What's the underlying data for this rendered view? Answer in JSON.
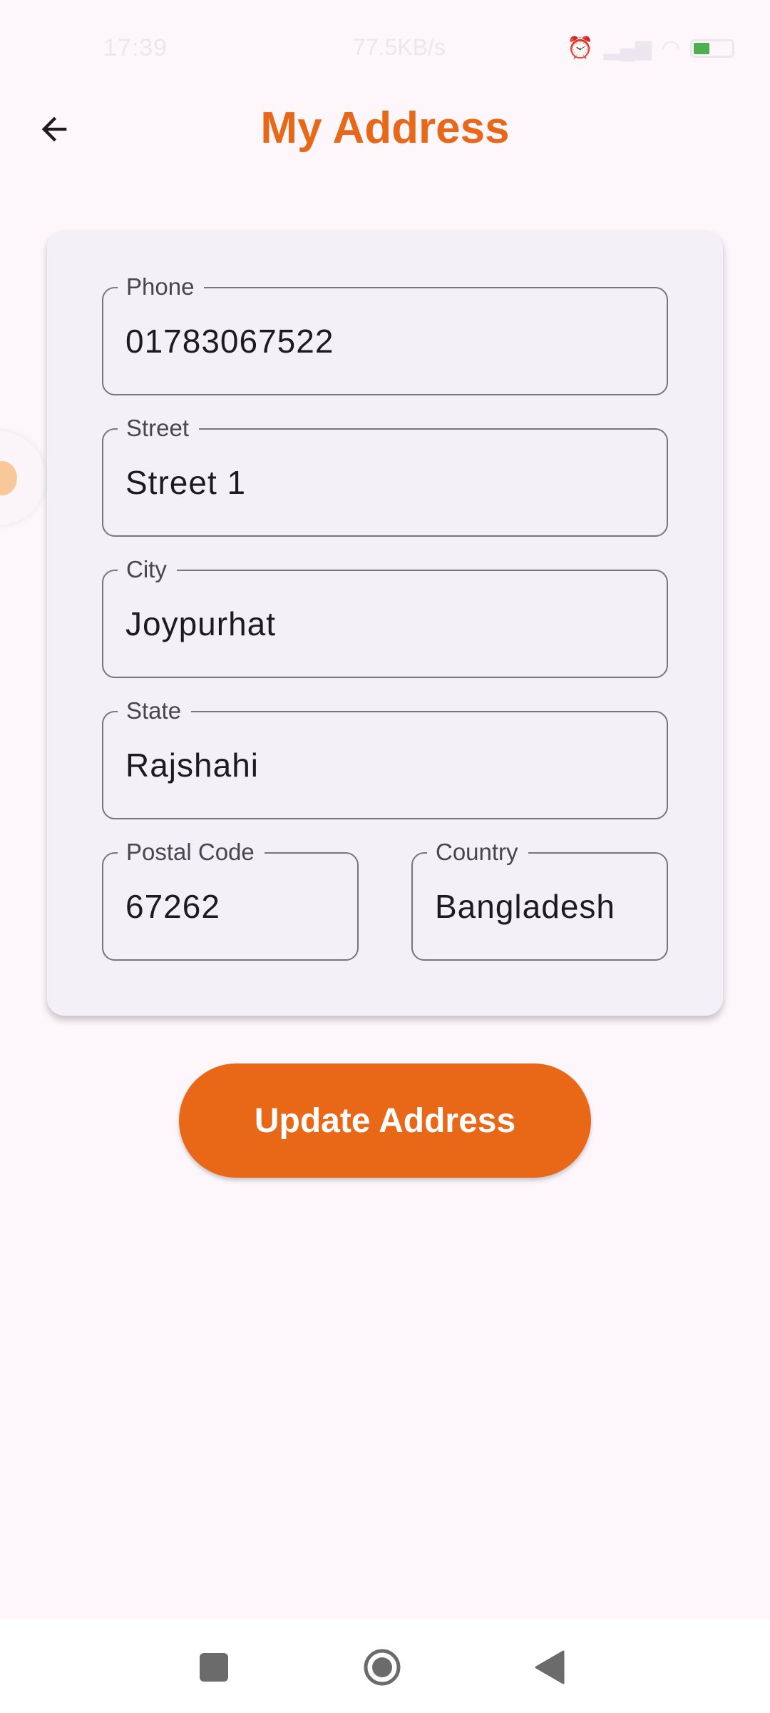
{
  "status": {
    "time": "17:39",
    "network_speed": "77.5KB/s",
    "battery_level": "4"
  },
  "header": {
    "title": "My Address",
    "back_icon": "arrow-left-icon"
  },
  "form": {
    "phone": {
      "label": "Phone",
      "value": "01783067522"
    },
    "street": {
      "label": "Street",
      "value": "Street 1"
    },
    "city": {
      "label": "City",
      "value": "Joypurhat"
    },
    "state": {
      "label": "State",
      "value": "Rajshahi"
    },
    "postal_code": {
      "label": "Postal Code",
      "value": "67262"
    },
    "country": {
      "label": "Country",
      "value": "Bangladesh"
    }
  },
  "actions": {
    "update_label": "Update Address"
  },
  "colors": {
    "accent": "#e96817",
    "background": "#fdf7fc",
    "card": "#f4f0f7",
    "border": "#79747e"
  },
  "nav": {
    "recents_icon": "square-icon",
    "home_icon": "circle-home-icon",
    "back_icon": "triangle-back-icon"
  }
}
